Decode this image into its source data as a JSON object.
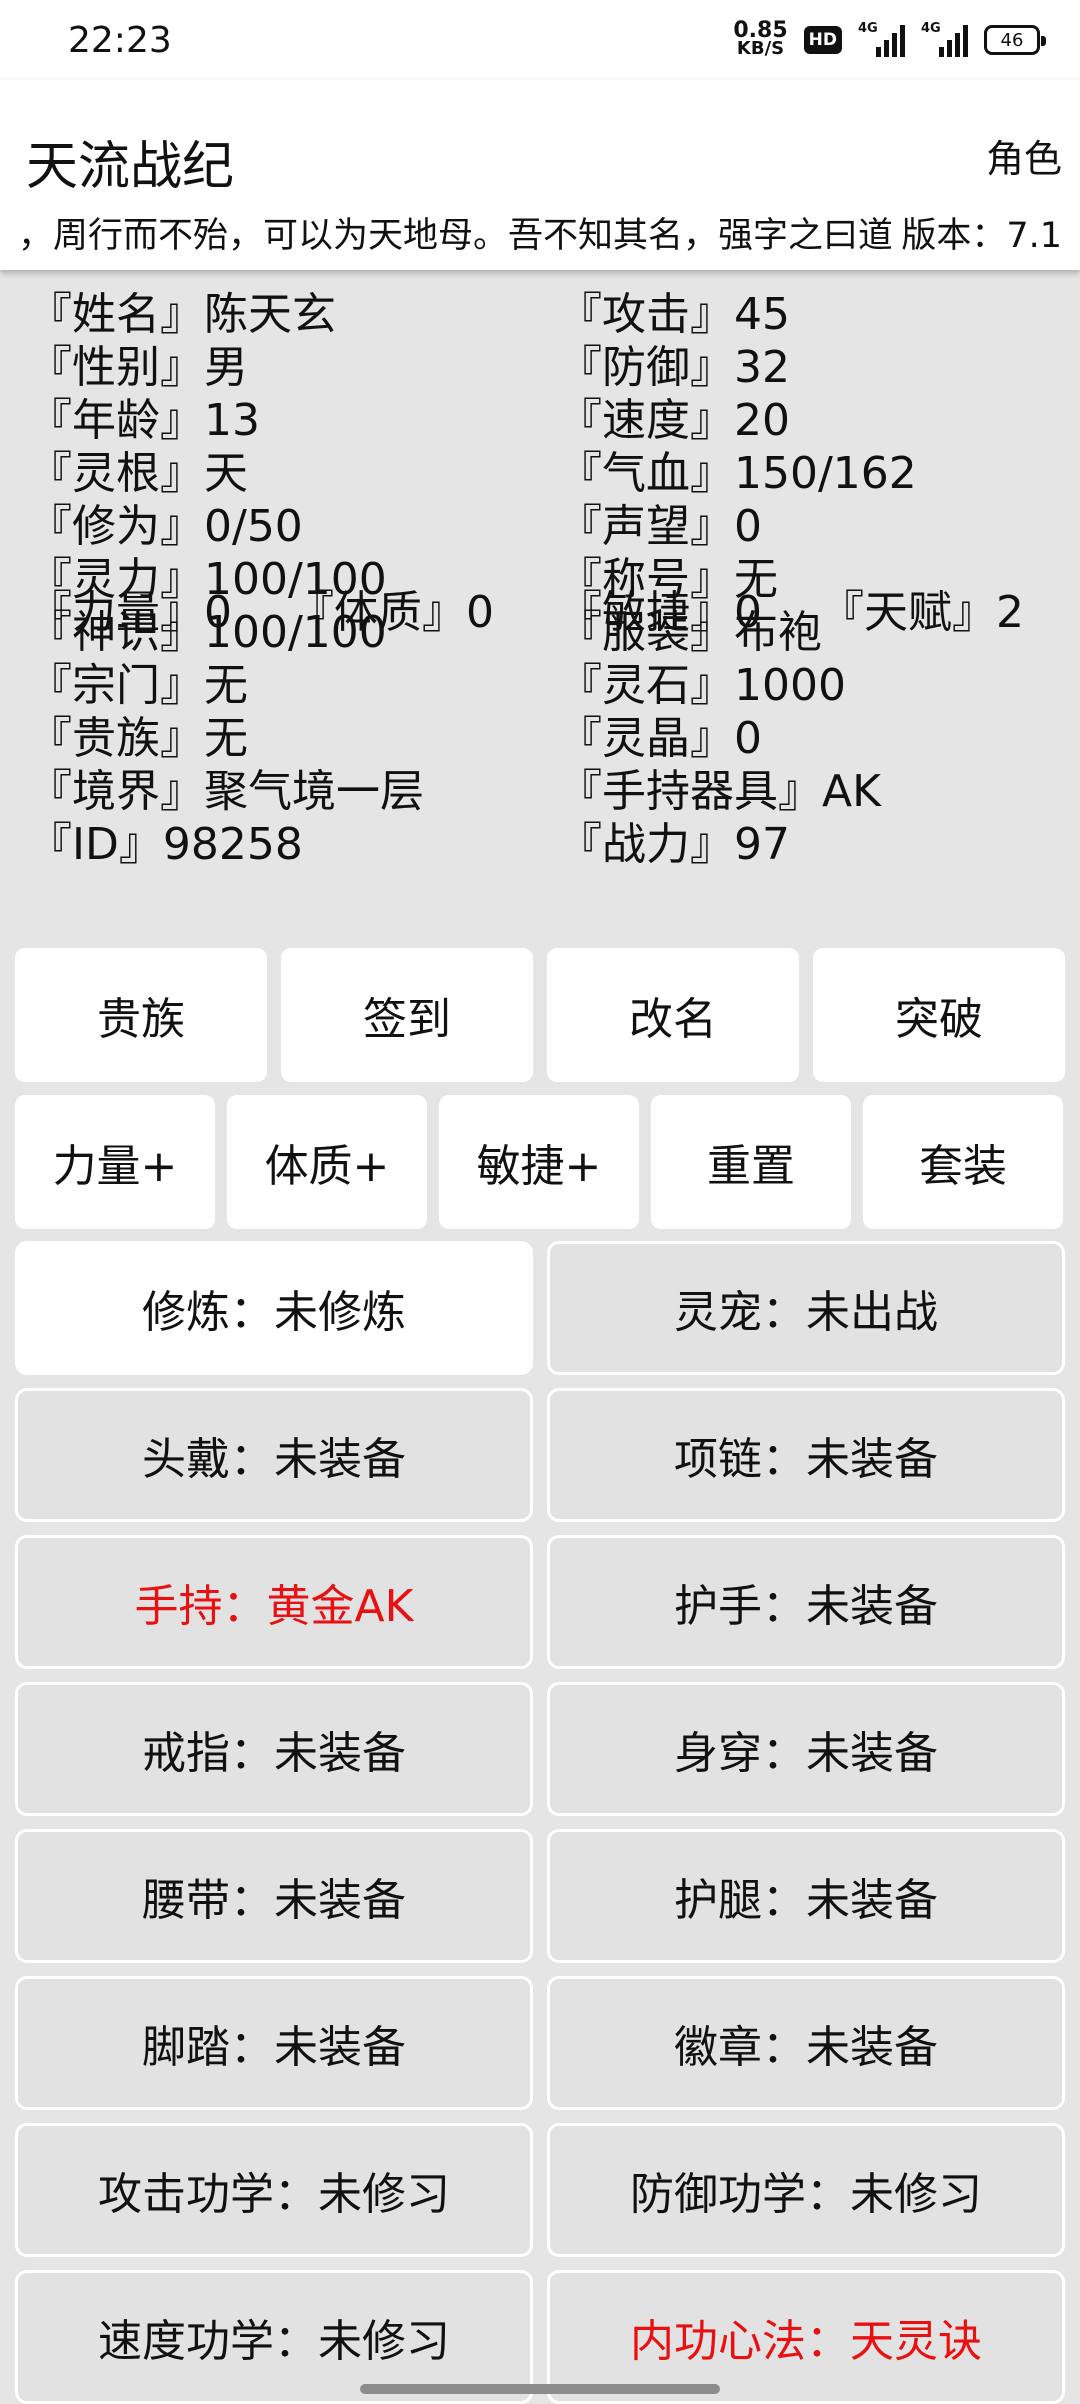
{
  "status_bar": {
    "time": "22:23",
    "net_speed_value": "0.85",
    "net_speed_unit": "KB/S",
    "hd_label": "HD",
    "signal1_label": "4G",
    "signal2_label": "4G",
    "battery": "46"
  },
  "header": {
    "title": "天流战纪",
    "role_link": "角色",
    "marquee": "，周行而不殆，可以为天地母。吾不知其名，强字之曰道",
    "version": "版本：7.1"
  },
  "stats_left": [
    "『姓名』陈天玄",
    "『性别』男",
    "『年龄』13",
    "『灵根』天",
    "『修为』0/50",
    "『灵力』100/100",
    "『神识』100/100",
    "『宗门』无",
    "『贵族』无",
    "『境界』聚气境一层",
    "『ID』98258"
  ],
  "stats_right": [
    "『攻击』45",
    "『防御』32",
    "『速度』20",
    "『气血』150/162",
    "『声望』0",
    "『称号』无",
    "『服装』布袍",
    "『灵石』1000",
    "『灵晶』0",
    "『手持器具』AK",
    "『战力』97"
  ],
  "attributes": [
    "『力量』0",
    "『体质』0",
    "『敏捷』0",
    "『天赋』2"
  ],
  "actions_row1": [
    "贵族",
    "签到",
    "改名",
    "突破"
  ],
  "actions_row2": [
    "力量+",
    "体质+",
    "敏捷+",
    "重置",
    "套装"
  ],
  "slots": [
    "修炼：未修炼",
    "灵宠：未出战",
    "头戴：未装备",
    "项链：未装备",
    "手持：黄金AK",
    "护手：未装备",
    "戒指：未装备",
    "身穿：未装备",
    "腰带：未装备",
    "护腿：未装备",
    "脚踏：未装备",
    "徽章：未装备",
    "攻击功学：未修习",
    "防御功学：未修习",
    "速度功学：未修习",
    "内功心法：天灵诀"
  ],
  "colors": {
    "highlight": "#e81010",
    "background": "#e5e5e5",
    "button": "#ffffff"
  }
}
